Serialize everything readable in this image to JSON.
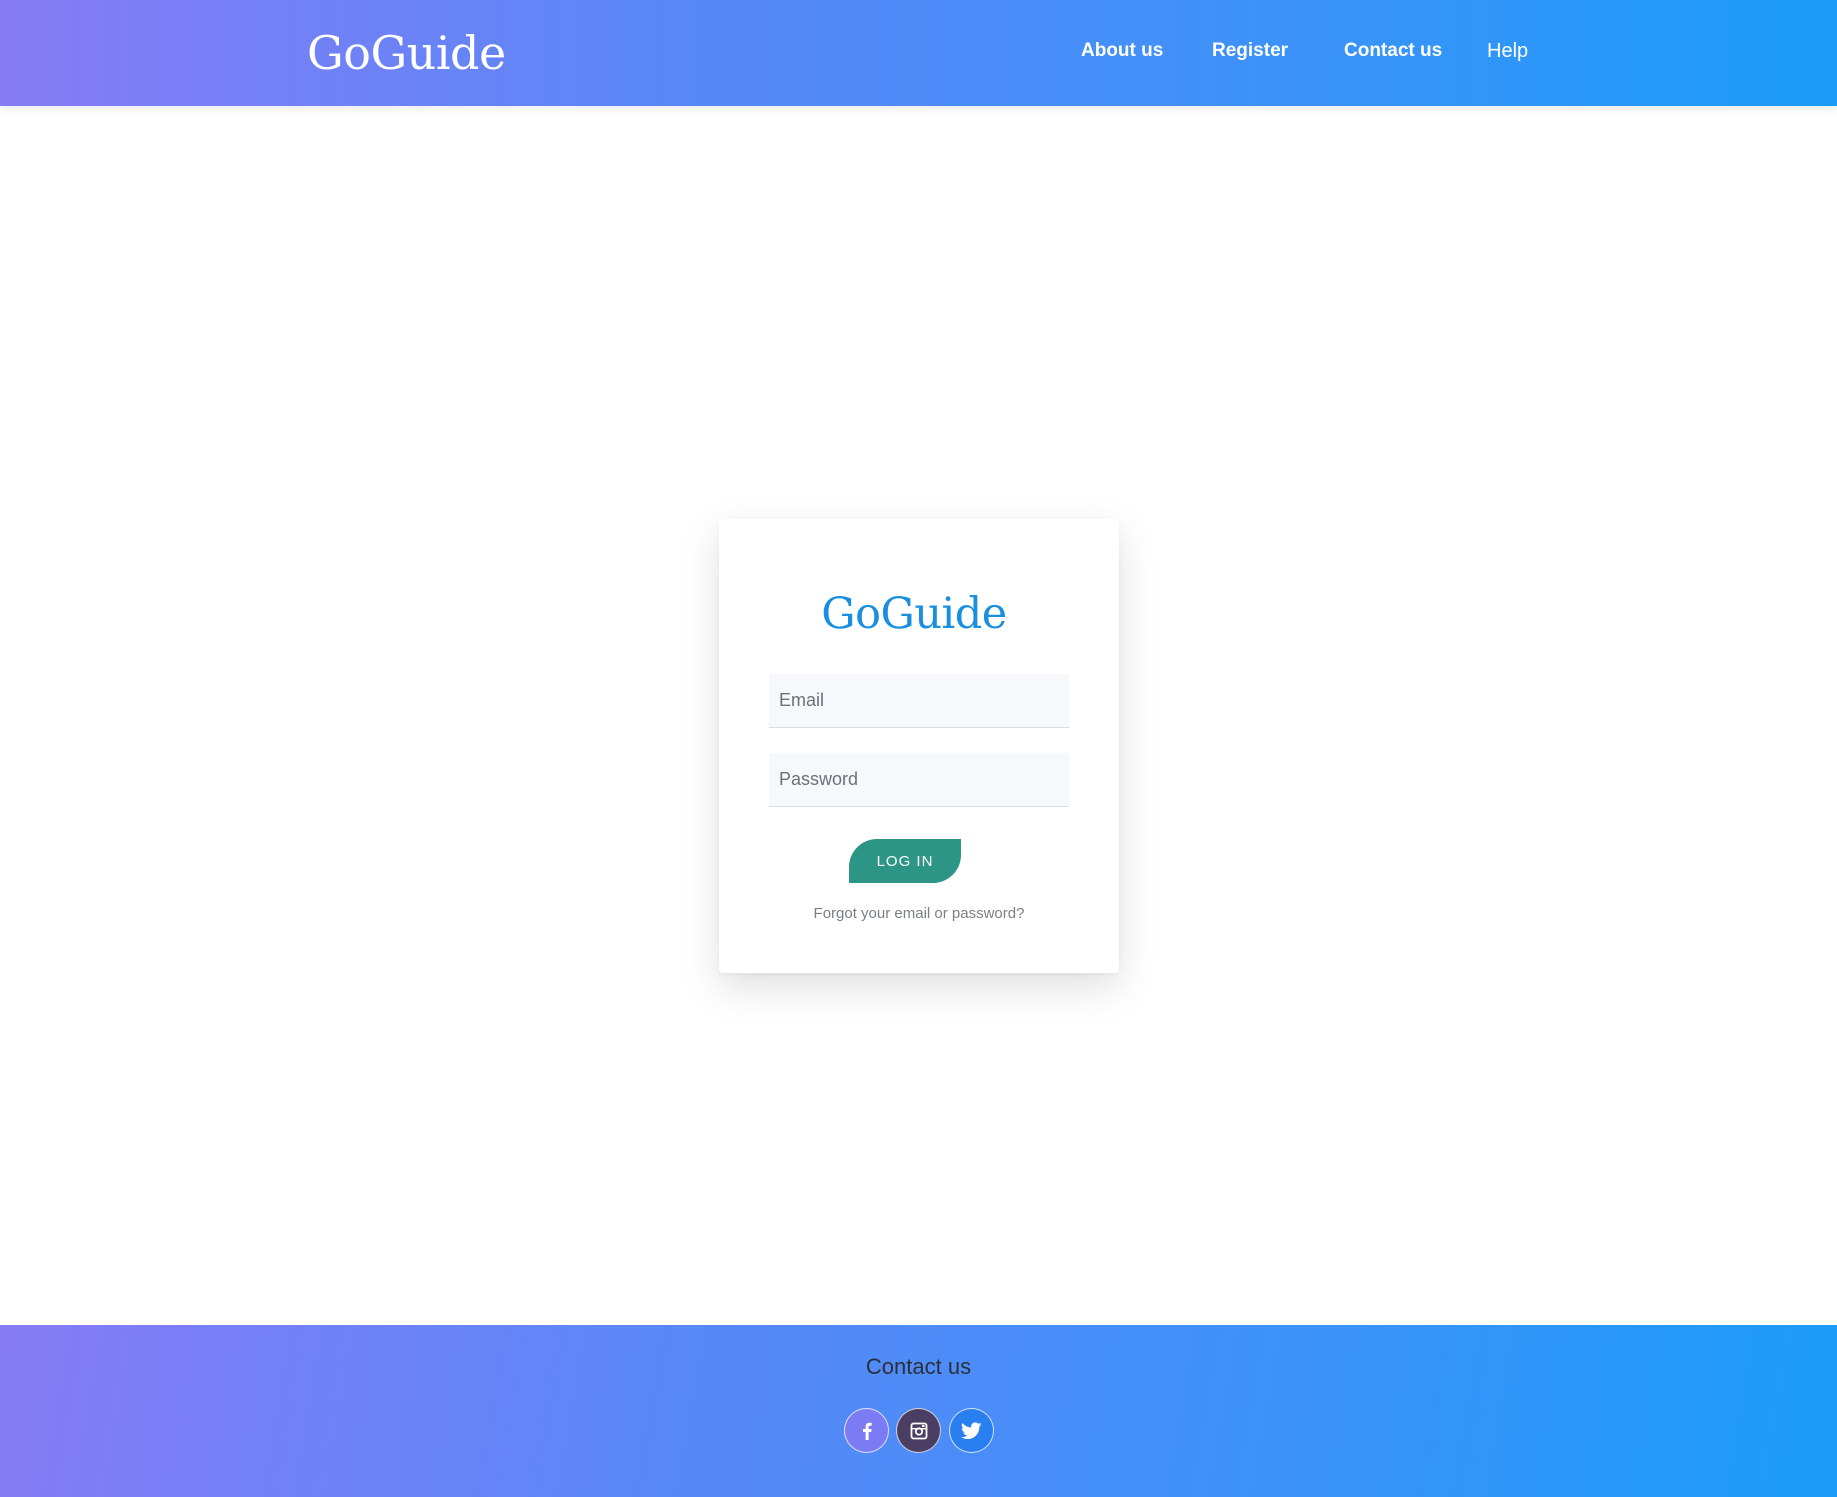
{
  "header": {
    "brand": "GoGuide",
    "nav": {
      "about": "About us",
      "register": "Register",
      "contact": "Contact us",
      "help": "Help"
    }
  },
  "login": {
    "logo": "GoGuide",
    "email_placeholder": "Email",
    "password_placeholder": "Password",
    "submit_label": "LOG IN",
    "forgot_label": "Forgot your email or password?"
  },
  "footer": {
    "title": "Contact us",
    "social": [
      {
        "icon": "facebook-icon"
      },
      {
        "icon": "instagram-icon"
      },
      {
        "icon": "twitter-icon"
      }
    ]
  },
  "colors": {
    "gradient_start": "#867bf5",
    "gradient_end": "#1a9cf8",
    "logo_blue": "#1a8fe0",
    "button_teal": "#2d9585"
  }
}
